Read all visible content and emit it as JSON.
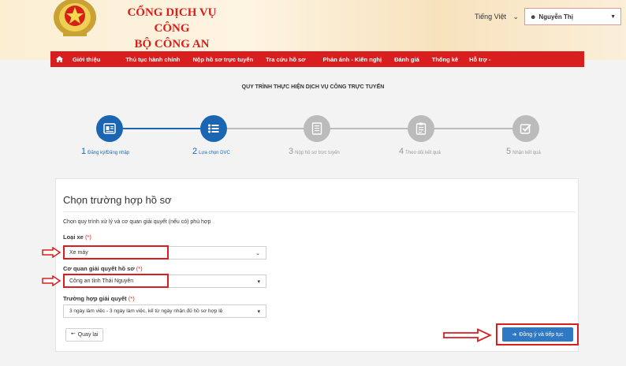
{
  "header": {
    "title_line1": "CỔNG DỊCH VỤ CÔNG",
    "title_line2": "BỘ CÔNG AN",
    "language": "Tiếng Việt",
    "user_name": "Nguyễn Thị"
  },
  "nav": {
    "items": [
      {
        "label": "Giới thiệu"
      },
      {
        "label": "Thủ tục hành chính"
      },
      {
        "label": "Nộp hồ sơ trực tuyến"
      },
      {
        "label": "Tra cứu hồ sơ"
      },
      {
        "label": "Phản ánh - Kiến nghị"
      },
      {
        "label": "Đánh giá"
      },
      {
        "label": "Thống kê"
      },
      {
        "label": "Hỗ trợ -"
      }
    ]
  },
  "flow": {
    "title": "QUY TRÌNH THỰC HIỆN DỊCH VỤ CÔNG TRỰC TUYẾN",
    "steps": [
      {
        "num": "1",
        "label": "Đăng ký/Đăng nhập",
        "active": true
      },
      {
        "num": "2",
        "label": "Lựa chọn DVC",
        "active": true
      },
      {
        "num": "3",
        "label": "Nộp hồ sơ trực tuyến",
        "active": false
      },
      {
        "num": "4",
        "label": "Theo dõi kết quả",
        "active": false
      },
      {
        "num": "5",
        "label": "Nhận kết quả",
        "active": false
      }
    ]
  },
  "form": {
    "title": "Chọn trường hợp hồ sơ",
    "description": "Chọn quy trình xử lý và cơ quan giải quyết (nếu có) phù hợp",
    "vehicle_type": {
      "label": "Loại xe",
      "required": "(*)",
      "value": "Xe máy"
    },
    "agency": {
      "label": "Cơ quan giải quyết hồ sơ",
      "required": "(*)",
      "value": "Công an tỉnh Thái Nguyên"
    },
    "case": {
      "label": "Trường hợp giải quyết",
      "required": "(*)",
      "value": "3 ngày làm việc - 3 ngày làm việc, kể từ ngày nhận đủ hồ sơ hợp lệ"
    },
    "back_label": "Quay lại",
    "next_label": "Đồng ý và tiếp tục"
  },
  "colors": {
    "brand_red": "#d81e1e",
    "step_active": "#1b66b3",
    "step_inactive": "#bbbbbb",
    "primary_button": "#2f79c4"
  }
}
